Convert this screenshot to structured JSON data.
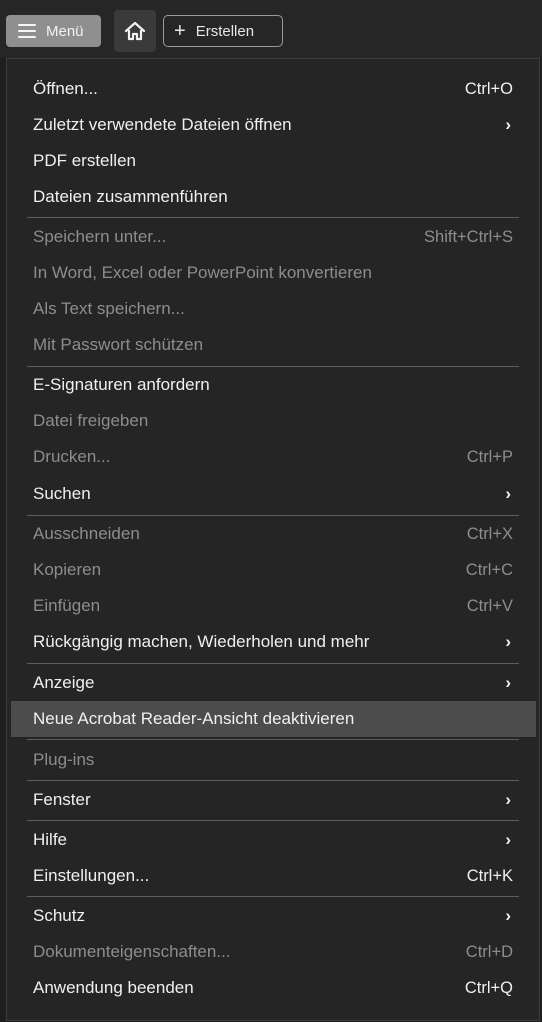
{
  "toolbar": {
    "menu_label": "Menü",
    "create_label": "Erstellen"
  },
  "menu": {
    "items": [
      {
        "label": "Öffnen...",
        "shortcut": "Ctrl+O",
        "enabled": true
      },
      {
        "label": "Zuletzt verwendete Dateien öffnen",
        "submenu": true,
        "enabled": true
      },
      {
        "label": "PDF erstellen",
        "enabled": true
      },
      {
        "label": "Dateien zusammenführen",
        "enabled": true
      },
      {
        "label": "Speichern unter...",
        "shortcut": "Shift+Ctrl+S",
        "enabled": false
      },
      {
        "label": "In Word, Excel oder PowerPoint konvertieren",
        "enabled": false
      },
      {
        "label": "Als Text speichern...",
        "enabled": false
      },
      {
        "label": "Mit Passwort schützen",
        "enabled": false
      },
      {
        "label": "E-Signaturen anfordern",
        "enabled": true
      },
      {
        "label": "Datei freigeben",
        "enabled": false
      },
      {
        "label": "Drucken...",
        "shortcut": "Ctrl+P",
        "enabled": false
      },
      {
        "label": "Suchen",
        "submenu": true,
        "enabled": true
      },
      {
        "label": "Ausschneiden",
        "shortcut": "Ctrl+X",
        "enabled": false
      },
      {
        "label": "Kopieren",
        "shortcut": "Ctrl+C",
        "enabled": false
      },
      {
        "label": "Einfügen",
        "shortcut": "Ctrl+V",
        "enabled": false
      },
      {
        "label": "Rückgängig machen, Wiederholen und mehr",
        "submenu": true,
        "enabled": true
      },
      {
        "label": "Anzeige",
        "submenu": true,
        "enabled": true
      },
      {
        "label": "Neue Acrobat Reader-Ansicht deaktivieren",
        "enabled": true,
        "highlighted": true
      },
      {
        "label": "Plug-ins",
        "enabled": false
      },
      {
        "label": "Fenster",
        "submenu": true,
        "enabled": true
      },
      {
        "label": "Hilfe",
        "submenu": true,
        "enabled": true
      },
      {
        "label": "Einstellungen...",
        "shortcut": "Ctrl+K",
        "enabled": true
      },
      {
        "label": "Schutz",
        "submenu": true,
        "enabled": true
      },
      {
        "label": "Dokumenteigenschaften...",
        "shortcut": "Ctrl+D",
        "enabled": false
      },
      {
        "label": "Anwendung beenden",
        "shortcut": "Ctrl+Q",
        "enabled": true
      }
    ]
  }
}
